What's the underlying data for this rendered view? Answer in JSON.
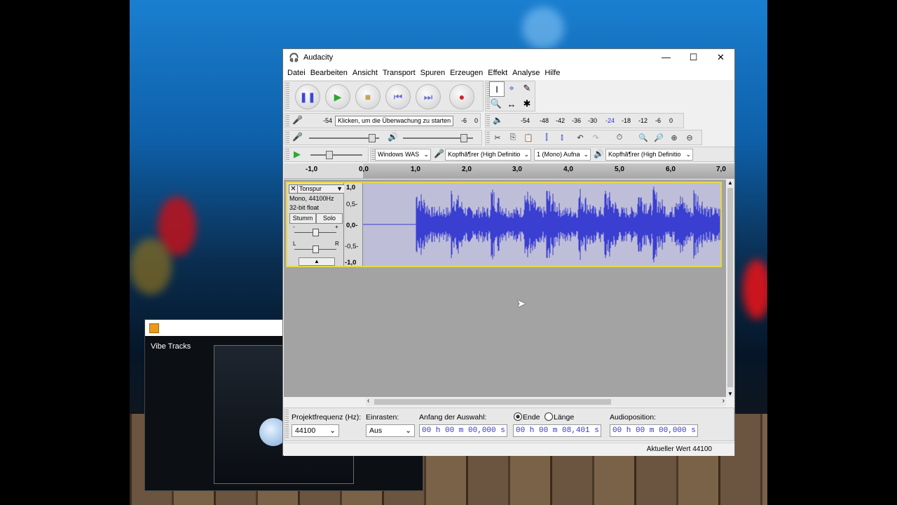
{
  "window_title": "Audacity",
  "menu": [
    "Datei",
    "Bearbeiten",
    "Ansicht",
    "Transport",
    "Spuren",
    "Erzeugen",
    "Effekt",
    "Analyse",
    "Hilfe"
  ],
  "meter": {
    "rec_scale": [
      "-54",
      "-6",
      "0"
    ],
    "rec_hint": "Klicken, um die Überwachung zu starten",
    "play_scale": [
      "-54",
      "-48",
      "-42",
      "-36",
      "-30",
      "-24",
      "-18",
      "-12",
      "-6",
      "0"
    ]
  },
  "device": {
    "host": "Windows WAS",
    "rec_device": "Kopfhã¶rer (High Definitio",
    "channels": "1 (Mono) Aufna",
    "play_device": "Kopfhã¶rer (High Definitio"
  },
  "timeline": [
    "-1,0",
    "0,0",
    "1,0",
    "2,0",
    "3,0",
    "4,0",
    "5,0",
    "6,0",
    "7,0"
  ],
  "track": {
    "name": "Tonspur",
    "rate": "Mono, 44100Hz",
    "format": "32-bit float",
    "mute": "Stumm",
    "solo": "Solo",
    "gain_left": "-",
    "gain_right": "+",
    "pan_left": "L",
    "pan_right": "R",
    "scale": [
      "1,0",
      "0,5-",
      "0,0-",
      "-0,5-",
      "-1,0"
    ],
    "color": "#3a3fd1"
  },
  "selection_bar": {
    "rate_label": "Projektfrequenz (Hz):",
    "rate_value": "44100",
    "snap_label": "Einrasten:",
    "snap_value": "Aus",
    "start_label": "Anfang der Auswahl:",
    "end_radio": "Ende",
    "length_radio": "Länge",
    "start_value": "00 h 00 m 00,000 s",
    "end_value": "00 h 00 m 08,401 s",
    "pos_label": "Audioposition:",
    "pos_value": "00 h 00 m 00,000 s"
  },
  "status": "Aktueller Wert 44100",
  "second_window": {
    "title": "Vibe Tracks"
  }
}
